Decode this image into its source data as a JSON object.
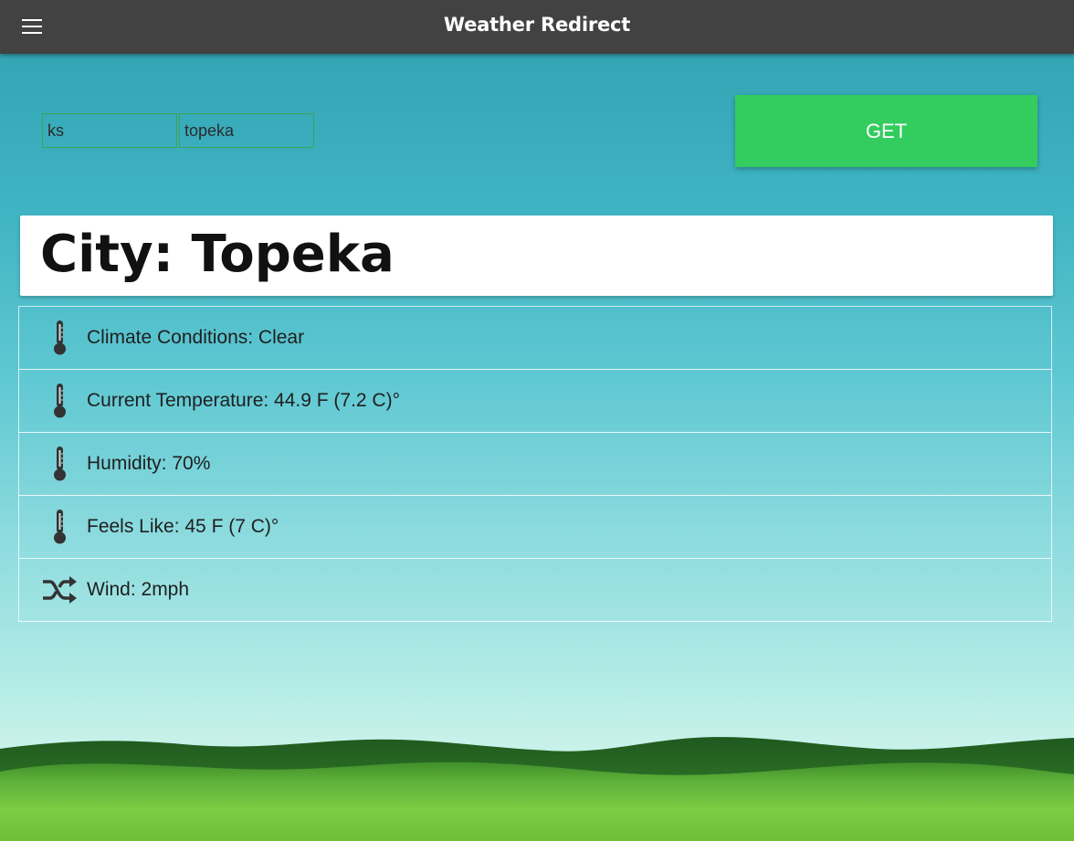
{
  "appbar": {
    "title": "Weather Redirect",
    "menu_icon": "menu-icon"
  },
  "search": {
    "state_value": "ks",
    "city_value": "topeka",
    "get_label": "GET"
  },
  "city_card": {
    "title": "City: Topeka"
  },
  "weather_items": [
    {
      "icon": "thermometer-icon",
      "text": "Climate Conditions: Clear"
    },
    {
      "icon": "thermometer-icon",
      "text": "Current Temperature: 44.9 F (7.2 C)°"
    },
    {
      "icon": "thermometer-icon",
      "text": "Humidity: 70%"
    },
    {
      "icon": "thermometer-icon",
      "text": "Feels Like: 45 F (7 C)°"
    },
    {
      "icon": "shuffle-icon",
      "text": "Wind: 2mph"
    }
  ],
  "colors": {
    "appbar": "#424242",
    "get_button": "#33cc5f",
    "input_border": "#3aa35a"
  }
}
